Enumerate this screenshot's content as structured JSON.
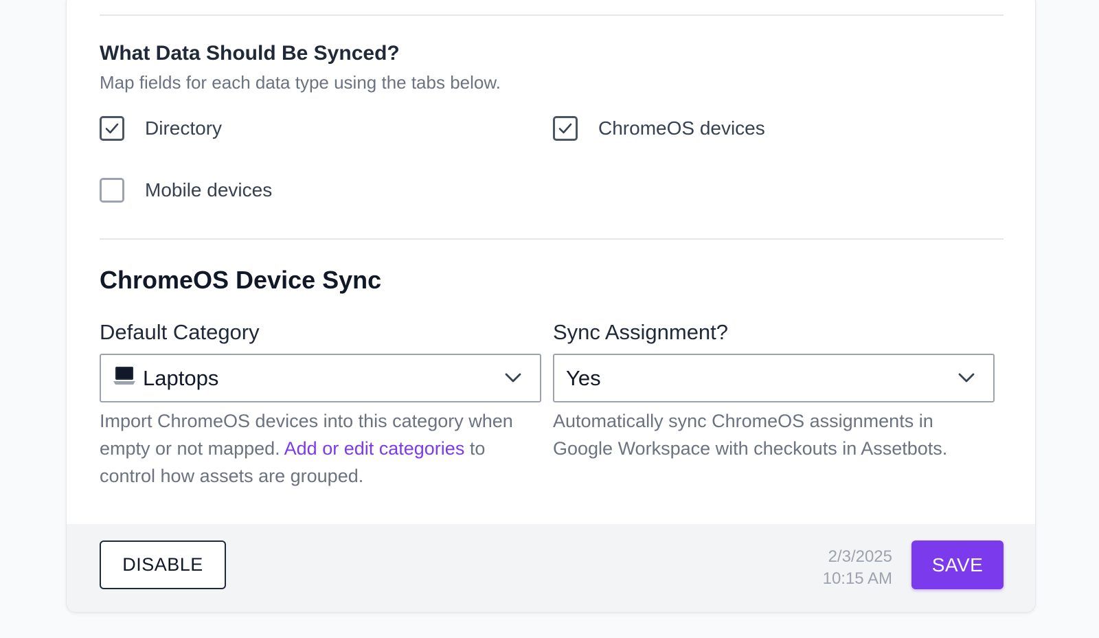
{
  "data_sync": {
    "title": "What Data Should Be Synced?",
    "subtitle": "Map fields for each data type using the tabs below.",
    "options": [
      {
        "label": "Directory",
        "checked": true
      },
      {
        "label": "ChromeOS devices",
        "checked": true
      },
      {
        "label": "Mobile devices",
        "checked": false
      }
    ]
  },
  "chromeos_sync": {
    "title": "ChromeOS Device Sync",
    "default_category": {
      "label": "Default Category",
      "value": "Laptops",
      "icon": "laptop-icon",
      "help_prefix": "Import ChromeOS devices into this category when empty or not mapped. ",
      "help_link": "Add or edit categories",
      "help_suffix": " to control how assets are grouped."
    },
    "sync_assignment": {
      "label": "Sync Assignment?",
      "value": "Yes",
      "help": "Automatically sync ChromeOS assignments in Google Workspace with checkouts in Assetbots."
    }
  },
  "footer": {
    "disable_label": "DISABLE",
    "date": "2/3/2025",
    "time": "10:15 AM",
    "save_label": "SAVE"
  },
  "colors": {
    "accent": "#7c3aed",
    "text": "#374151",
    "muted": "#6b7280"
  }
}
